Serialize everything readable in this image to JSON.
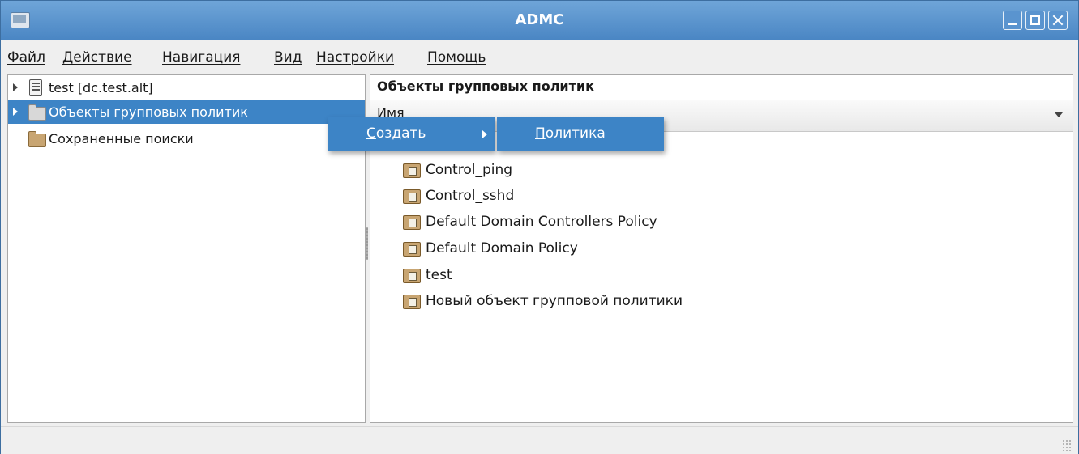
{
  "window": {
    "title": "ADMC"
  },
  "menubar": {
    "items": [
      {
        "label": "Файл"
      },
      {
        "label": "Действие"
      },
      {
        "label": "Навигация"
      },
      {
        "label": "Вид"
      },
      {
        "label": "Настройки"
      },
      {
        "label": "Помощь"
      }
    ]
  },
  "tree": {
    "items": [
      {
        "label": "test [dc.test.alt]",
        "icon": "server-icon",
        "expandable": true,
        "selected": false
      },
      {
        "label": "Объекты групповых политик",
        "icon": "folder-icon",
        "expandable": true,
        "selected": true
      },
      {
        "label": "Сохраненные поиски",
        "icon": "folder-icon",
        "expandable": false,
        "selected": false
      }
    ]
  },
  "right_pane": {
    "title": "Объекты групповых политик",
    "column_header": "Имя",
    "items": [
      {
        "label": "Control_ping"
      },
      {
        "label": "Control_sshd"
      },
      {
        "label": "Default Domain Controllers Policy"
      },
      {
        "label": "Default Domain Policy"
      },
      {
        "label": "test"
      },
      {
        "label": "Новый объект групповой политики"
      }
    ]
  },
  "context_menu": {
    "item": {
      "label_mnemonic": "С",
      "label_rest": "оздать"
    },
    "submenu": {
      "item": {
        "label_mnemonic": "П",
        "label_rest": "олитика"
      }
    }
  },
  "colors": {
    "selection": "#3d84c6",
    "titlebar": "#4a86c4"
  }
}
